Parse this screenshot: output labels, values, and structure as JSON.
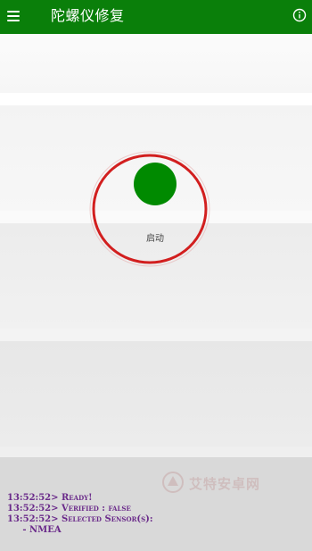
{
  "app_bar": {
    "title": "陀螺仪修复",
    "menu_icon": "menu-icon",
    "info_icon": "info-icon",
    "background": "#0a7f0a"
  },
  "main": {
    "start_button": {
      "label": "启动",
      "color": "#008a00"
    },
    "annotation_color": "#d21f1f"
  },
  "watermark": {
    "text": "艾特安卓网"
  },
  "log": {
    "lines": [
      "13:52:52> Ready!",
      "13:52:52> Verified : false",
      "13:52:52> Selected Sensor(s):",
      "     - NMEA"
    ],
    "color": "#6a2a8a"
  }
}
